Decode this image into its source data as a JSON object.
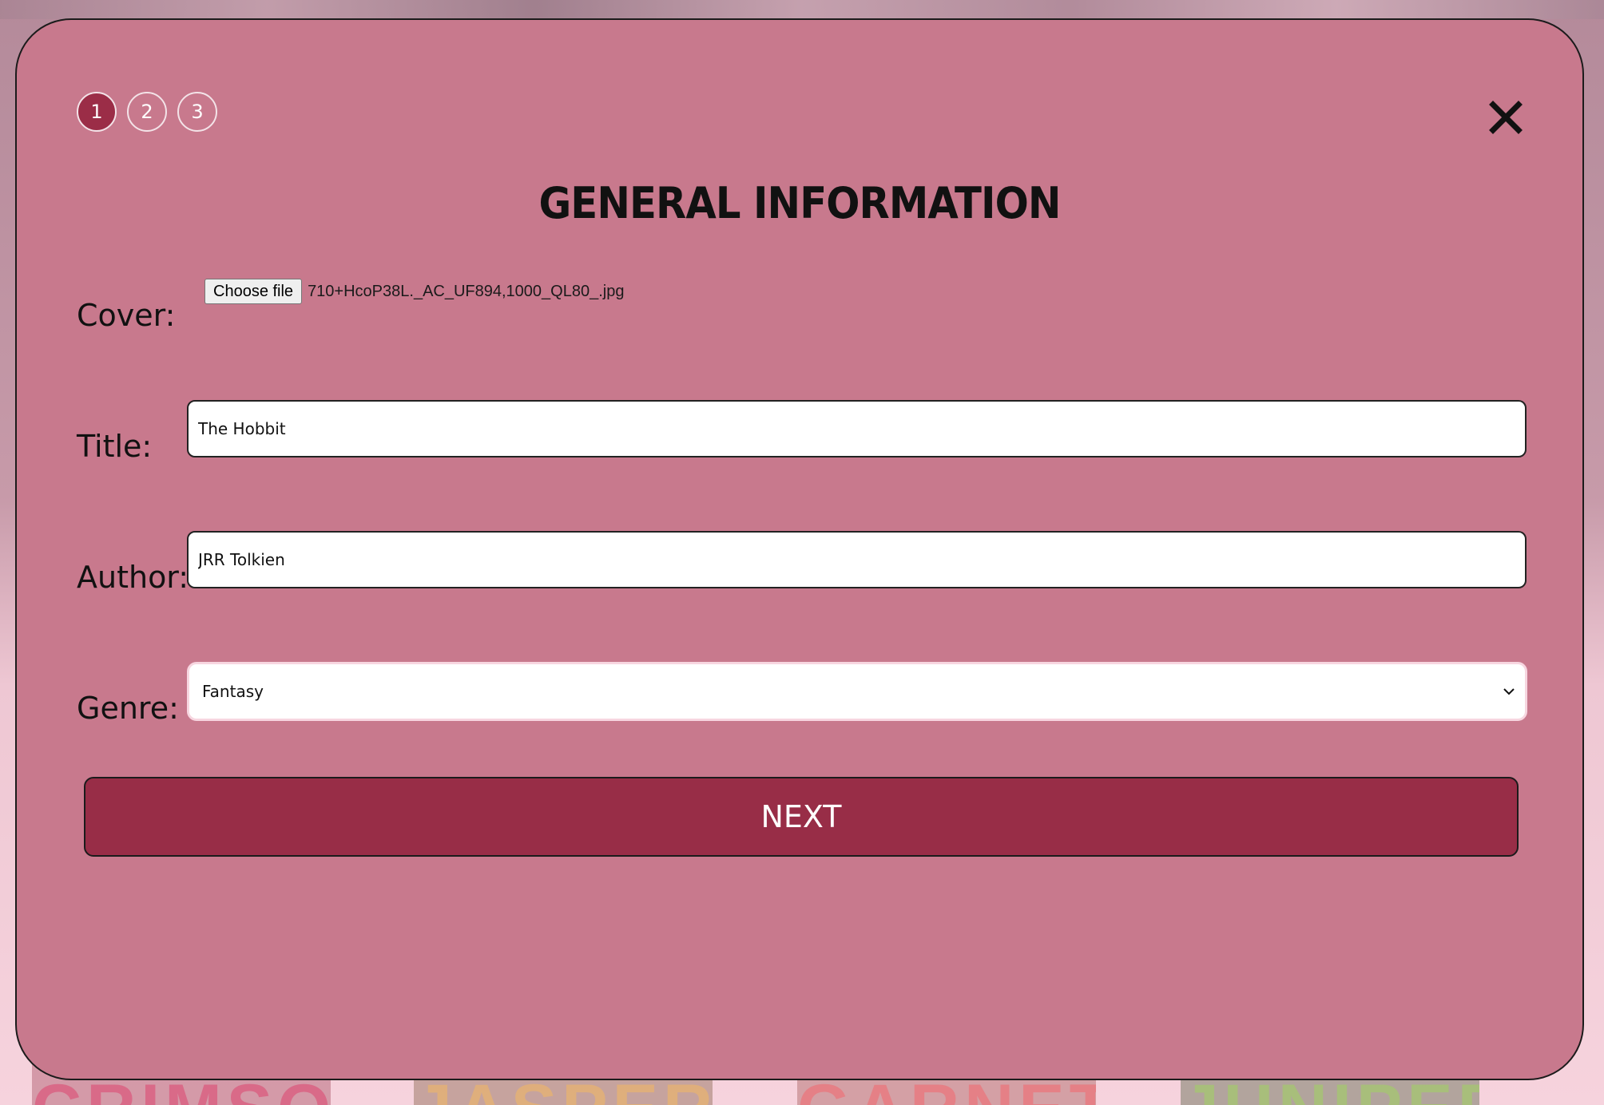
{
  "background": {
    "cover_titles": [
      "CRIMSON",
      "JASPER",
      "GARNET",
      "JUNIPER"
    ]
  },
  "modal": {
    "steps": [
      "1",
      "2",
      "3"
    ],
    "active_step": "1",
    "close_icon": "close-icon",
    "title": "GENERAL INFORMATION",
    "cover": {
      "label": "Cover:",
      "button_label": "Choose file",
      "file_name": "710+HcoP38L._AC_UF894,1000_QL80_.jpg"
    },
    "title_field": {
      "label": "Title:",
      "value": "The Hobbit"
    },
    "author_field": {
      "label": "Author:",
      "value": "JRR Tolkien"
    },
    "genre_field": {
      "label": "Genre:",
      "selected": "Fantasy",
      "chevron_icon": "chevron-down-icon"
    },
    "next_label": "NEXT"
  },
  "colors": {
    "modal_bg": "#c8798d",
    "accent": "#982d47",
    "active_step": "#9b2d47"
  }
}
